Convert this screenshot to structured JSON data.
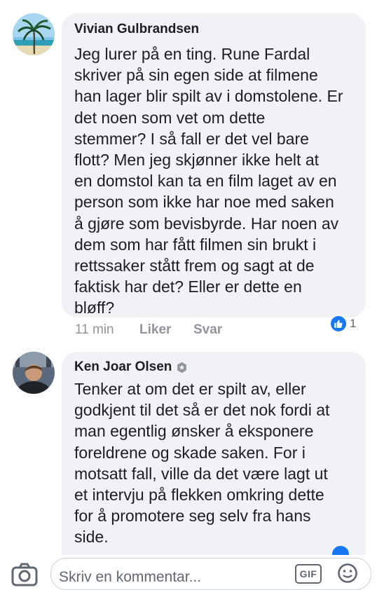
{
  "comments": [
    {
      "author": "Vivian Gulbrandsen",
      "text": "Jeg lurer på en ting. Rune Fardal\nskriver på sin egen side at filmene\nhan lager blir spilt av i domstolene. Er\ndet noen som vet om dette\nstemmer? I så fall er det vel bare\nflott? Men  jeg skjønner ikke helt at\nen domstol kan ta en film laget av en\nperson som ikke har noe med saken\nå gjøre som bevisbyrde. Har noen av\ndem som har fått filmen sin brukt i\nrettssaker stått frem og sagt at de\nfaktisk har det? Eller er dette en\nbløff?",
      "time": "11 min",
      "like_label": "Liker",
      "reply_label": "Svar",
      "reaction_count": "1"
    },
    {
      "author": "Ken Joar Olsen",
      "text": "Tenker at om det er spilt av, eller\ngodkjent til det så er det nok fordi at\nman egentlig ønsker å eksponere\nforeldrene og skade saken. For i\nmotsatt fall, ville da det være lagt ut\net intervju på flekken omkring dette\nfor å promotere seg selv fra hans\nside."
    }
  ],
  "composer": {
    "placeholder": "Skriv en kommentar...",
    "gif_label": "GIF"
  },
  "colors": {
    "bubble": "#f0f2f5",
    "like_blue": "#1877f2",
    "meta_gray": "#90949c"
  },
  "icons": [
    "camera-icon",
    "gif-icon",
    "emoji-icon",
    "like-icon",
    "badge-icon"
  ]
}
